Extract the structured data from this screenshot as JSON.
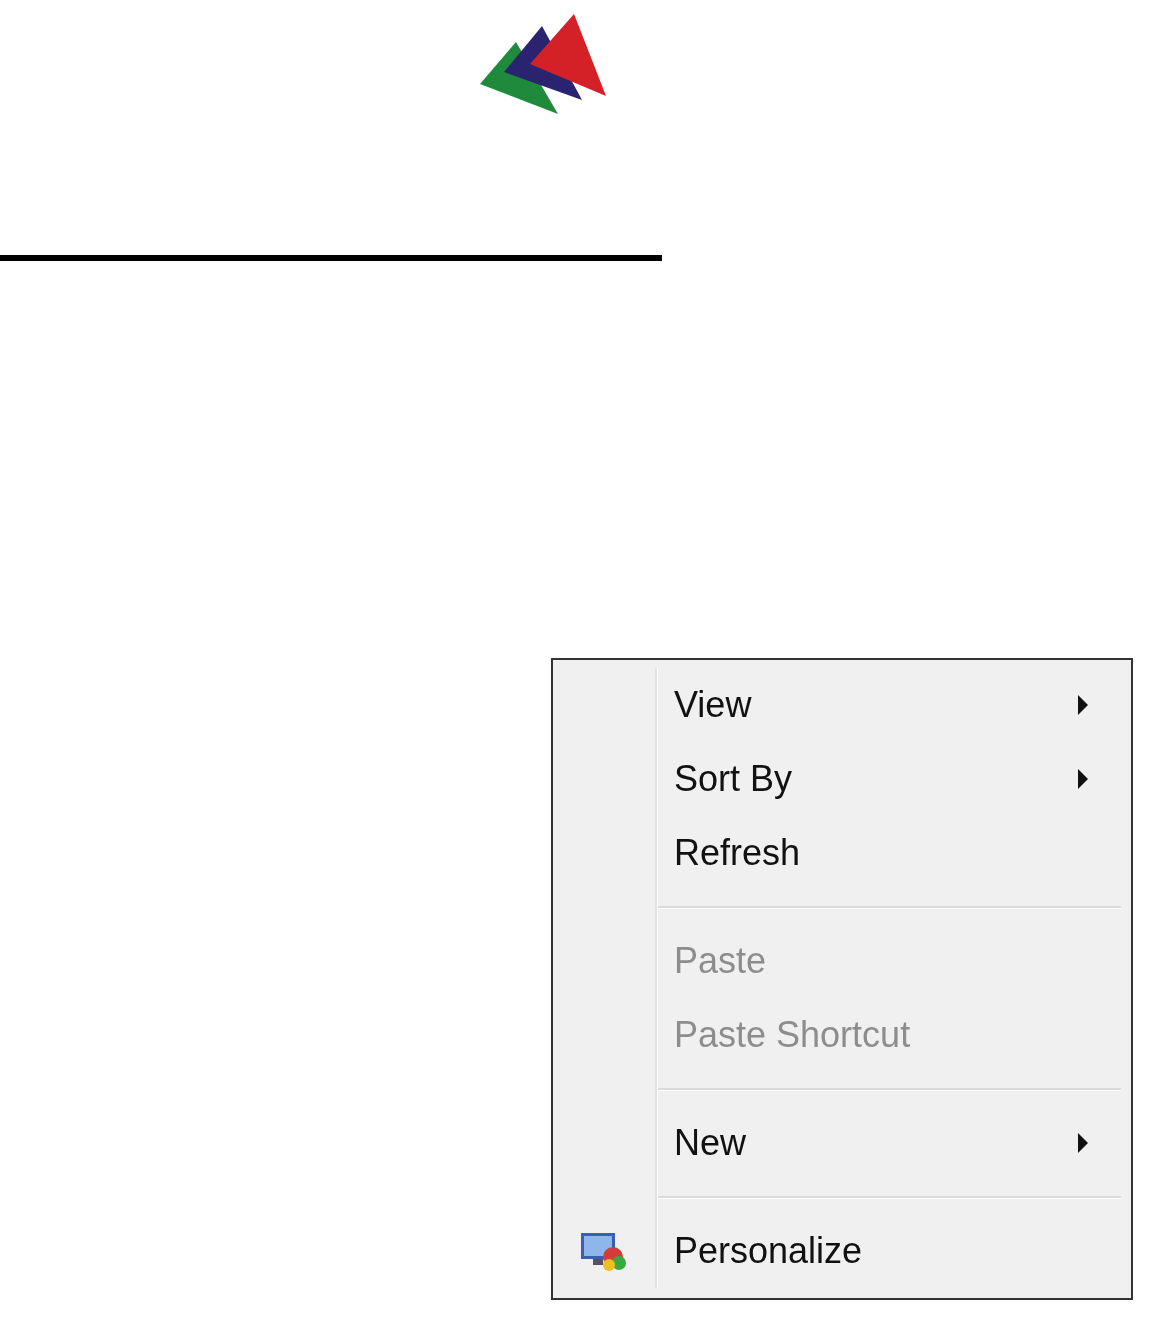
{
  "context_menu": {
    "items": [
      {
        "kind": "item",
        "label": "View",
        "disabled": false,
        "submenu": true,
        "has_icon": false
      },
      {
        "kind": "item",
        "label": "Sort By",
        "disabled": false,
        "submenu": true,
        "has_icon": false
      },
      {
        "kind": "item",
        "label": "Refresh",
        "disabled": false,
        "submenu": false,
        "has_icon": false
      },
      {
        "kind": "separator"
      },
      {
        "kind": "item",
        "label": "Paste",
        "disabled": true,
        "submenu": false,
        "has_icon": false
      },
      {
        "kind": "item",
        "label": "Paste Shortcut",
        "disabled": true,
        "submenu": false,
        "has_icon": false
      },
      {
        "kind": "separator"
      },
      {
        "kind": "item",
        "label": "New",
        "disabled": false,
        "submenu": true,
        "has_icon": false
      },
      {
        "kind": "separator"
      },
      {
        "kind": "item",
        "label": "Personalize",
        "disabled": false,
        "submenu": false,
        "has_icon": true
      }
    ]
  }
}
